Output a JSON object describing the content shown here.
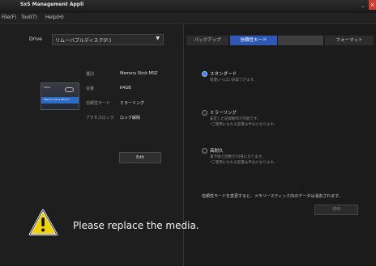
{
  "window": {
    "title": "SxS Management Appli",
    "minimize": "_",
    "close": "×"
  },
  "menu": [
    "File(F)",
    "Tool(T)",
    "Help(H)"
  ],
  "drive": {
    "label": "Drive",
    "value": "リムーバブルディスク(F:)",
    "arrow": "▼"
  },
  "media_info": {
    "card_logo": "SONY",
    "card_band": "Memory Stick MS Pro",
    "rows": [
      {
        "key": "種別",
        "value": "Memory Stick MSZ"
      },
      {
        "key": "容量",
        "value": "64GB"
      },
      {
        "key": "信頼性モード",
        "value": "ミラーリング"
      },
      {
        "key": "アクセスロック",
        "value": "ロック解除"
      }
    ]
  },
  "edit_button": "Edit",
  "tabs": [
    {
      "label": "バックアップ"
    },
    {
      "label": "信頼性モード"
    },
    {
      "label": ""
    },
    {
      "label": "フォーマット"
    }
  ],
  "options": [
    {
      "title": "スタンダード",
      "desc1": "容量いっぱい記録できます。",
      "desc2": "",
      "checked": true
    },
    {
      "title": "ミラーリング",
      "desc1": "安定した記録動作が可能です。",
      "desc2": "*ご使用になれる容量は半分になります。",
      "checked": false
    },
    {
      "title": "高耐久",
      "desc1": "書き換え回数が10倍になります。",
      "desc2": "*ご使用になれる容量は半分になります。",
      "checked": false
    }
  ],
  "notice": "信頼性モードを変更すると、メモリースティック内のデータは消去されます。",
  "apply_button": "適用",
  "warning": {
    "message": "Please replace the media."
  },
  "colors": {
    "accent": "#2f57b5",
    "radio_checked": "#3a82ea",
    "warning": "#f2d100"
  }
}
